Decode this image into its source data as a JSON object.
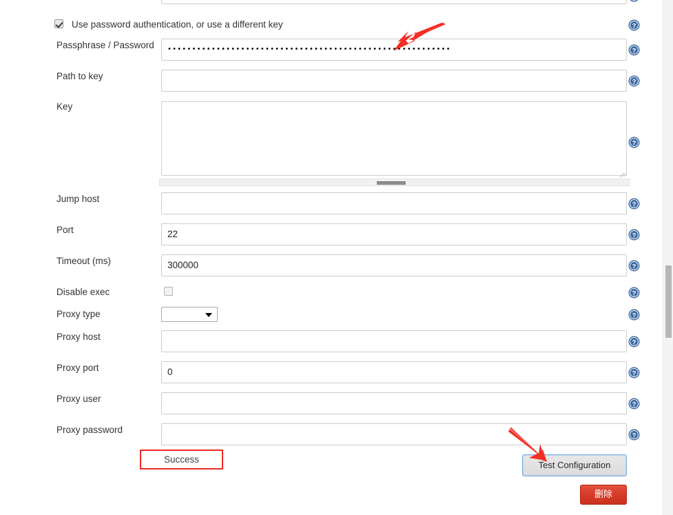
{
  "form": {
    "password_auth_checkbox": {
      "label": "Use password authentication, or use a different key",
      "checked": true
    },
    "fields": [
      {
        "name": "passphrase-password",
        "label": "Passphrase / Password",
        "type": "password",
        "value": "••••••••••••••••••••••••••••••••••••••••••••••••••••••••••",
        "placeholder": ""
      },
      {
        "name": "path-to-key",
        "label": "Path to key",
        "type": "text",
        "value": "",
        "placeholder": ""
      },
      {
        "name": "key",
        "label": "Key",
        "type": "textarea",
        "value": "",
        "placeholder": ""
      },
      {
        "name": "jump-host",
        "label": "Jump host",
        "type": "text",
        "value": "",
        "placeholder": ""
      },
      {
        "name": "port",
        "label": "Port",
        "type": "text",
        "value": "22",
        "placeholder": ""
      },
      {
        "name": "timeout-ms",
        "label": "Timeout (ms)",
        "type": "text",
        "value": "300000",
        "placeholder": ""
      },
      {
        "name": "disable-exec",
        "label": "Disable exec",
        "type": "checkbox",
        "checked": false
      },
      {
        "name": "proxy-type",
        "label": "Proxy type",
        "type": "select",
        "value": "",
        "options": [
          ""
        ]
      },
      {
        "name": "proxy-host",
        "label": "Proxy host",
        "type": "text",
        "value": "",
        "placeholder": ""
      },
      {
        "name": "proxy-port",
        "label": "Proxy port",
        "type": "text",
        "value": "0",
        "placeholder": ""
      },
      {
        "name": "proxy-user",
        "label": "Proxy user",
        "type": "text",
        "value": "",
        "placeholder": ""
      },
      {
        "name": "proxy-password",
        "label": "Proxy password",
        "type": "text",
        "value": "",
        "placeholder": ""
      }
    ]
  },
  "status": {
    "message": "Success"
  },
  "actions": {
    "test_configuration": "Test Configuration",
    "delete": "删除"
  },
  "icons": {
    "help": "help-circle-icon",
    "dropdown": "chevron-down-icon"
  },
  "colors": {
    "annotation_red": "#ee2b24",
    "help_blue": "#3c6ba5",
    "focus_blue": "#7aaee8",
    "delete_red": "#d63a26"
  }
}
